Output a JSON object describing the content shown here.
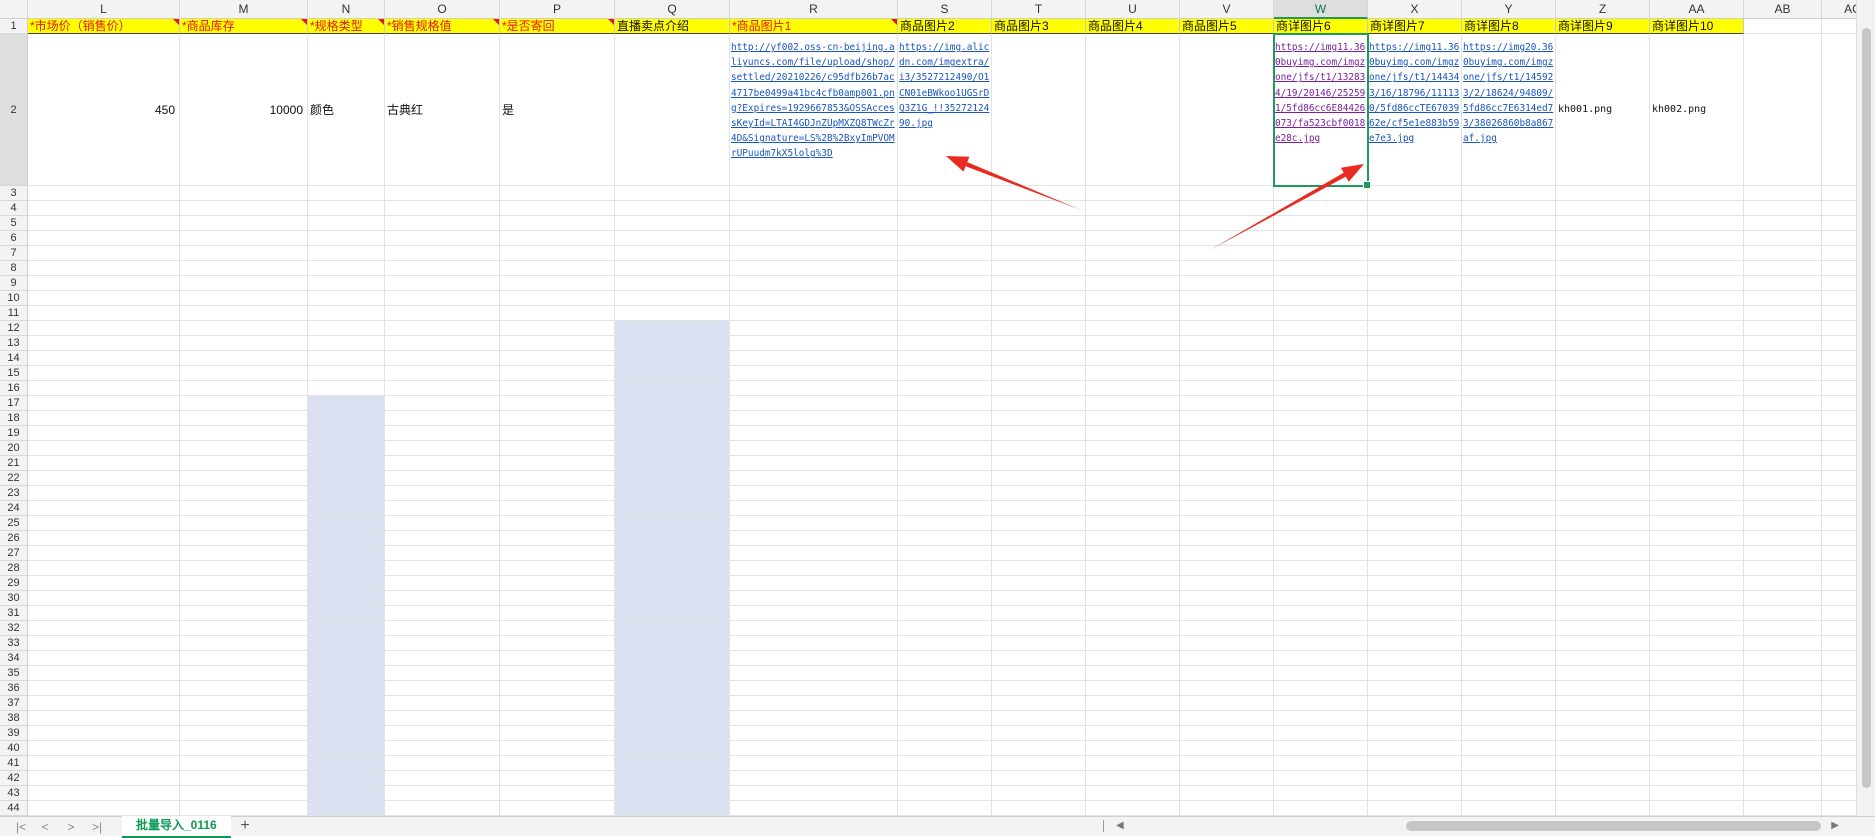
{
  "sheet": {
    "columns": [
      "L",
      "M",
      "N",
      "O",
      "P",
      "Q",
      "R",
      "S",
      "T",
      "U",
      "V",
      "W",
      "X",
      "Y",
      "Z",
      "AA",
      "AB",
      "AC"
    ],
    "selected_column": "W",
    "row_labels": [
      "1",
      "2",
      "3",
      "4",
      "5",
      "6",
      "7",
      "8",
      "9",
      "10",
      "11",
      "12",
      "13",
      "14",
      "15",
      "16",
      "17",
      "18",
      "19",
      "20",
      "21",
      "22",
      "23",
      "24",
      "25",
      "26",
      "27",
      "28",
      "29",
      "30",
      "31",
      "32",
      "33",
      "34",
      "35",
      "36",
      "37",
      "38",
      "39",
      "40",
      "41",
      "42",
      "43",
      "44"
    ],
    "header_row": {
      "L": "*市场价（销售价）",
      "M": "*商品库存",
      "N": "*规格类型",
      "O": "*销售规格值",
      "P": "*是否寄回",
      "Q": "直播卖点介绍",
      "R": "*商品图片1",
      "S": "商品图片2",
      "T": "商品图片3",
      "U": "商品图片4",
      "V": "商品图片5",
      "W": "商详图片6",
      "X": "商详图片7",
      "Y": "商详图片8",
      "Z": "商详图片9",
      "AA": "商详图片10"
    },
    "data_row": {
      "L": "450",
      "M": "10000",
      "N": "颜色",
      "O": "古典红",
      "P": "是",
      "R": "http://yf002.oss-cn-beijing.aliyuncs.com/file/upload/shop/settled/20210226/c95dfb26b7ac4717be0499a41bc4cfb0amp001.png?Expires=1929667853&OSSAccessKeyId=LTAI4GDJnZUpMXZQ8TWcZr4D&Signature=LS%2B%2BxyImPVOMrUPuudm7kX5lolg%3D",
      "S": "https://img.alicdn.com/imgextra/i3/3527212490/O1CN01eBWkoo1UGSrDQ3Z1G_!!3527212490.jpg",
      "W": "https://img11.360buyimg.com/imgzone/jfs/t1/132834/19/20146/252591/5fd86cc6E84426073/fa523cbf0018e28c.jpg",
      "X": "https://img11.360buyimg.com/imgzone/jfs/t1/144343/16/18796/111130/5fd86ccTE6703962e/cf5e1e883b59e7e3.jpg",
      "Y": "https://img20.360buyimg.com/imgzone/jfs/t1/145923/2/18624/94809/5fd86cc7E6314ed73/38026860b8a867af.jpg",
      "Z": "kh001.png",
      "AA": "kh002.png"
    }
  },
  "tabs": {
    "active": "批量导入_0116",
    "add_label": "+"
  },
  "nav": {
    "first": "|<",
    "prev": "<",
    "next": ">",
    "last": ">|"
  },
  "colors": {
    "header_fill": "#ffff00",
    "required_text": "#e3181c",
    "selection": "#1f9a5a",
    "annotation_arrow": "#e82a1f",
    "link": "#1a55c2"
  }
}
